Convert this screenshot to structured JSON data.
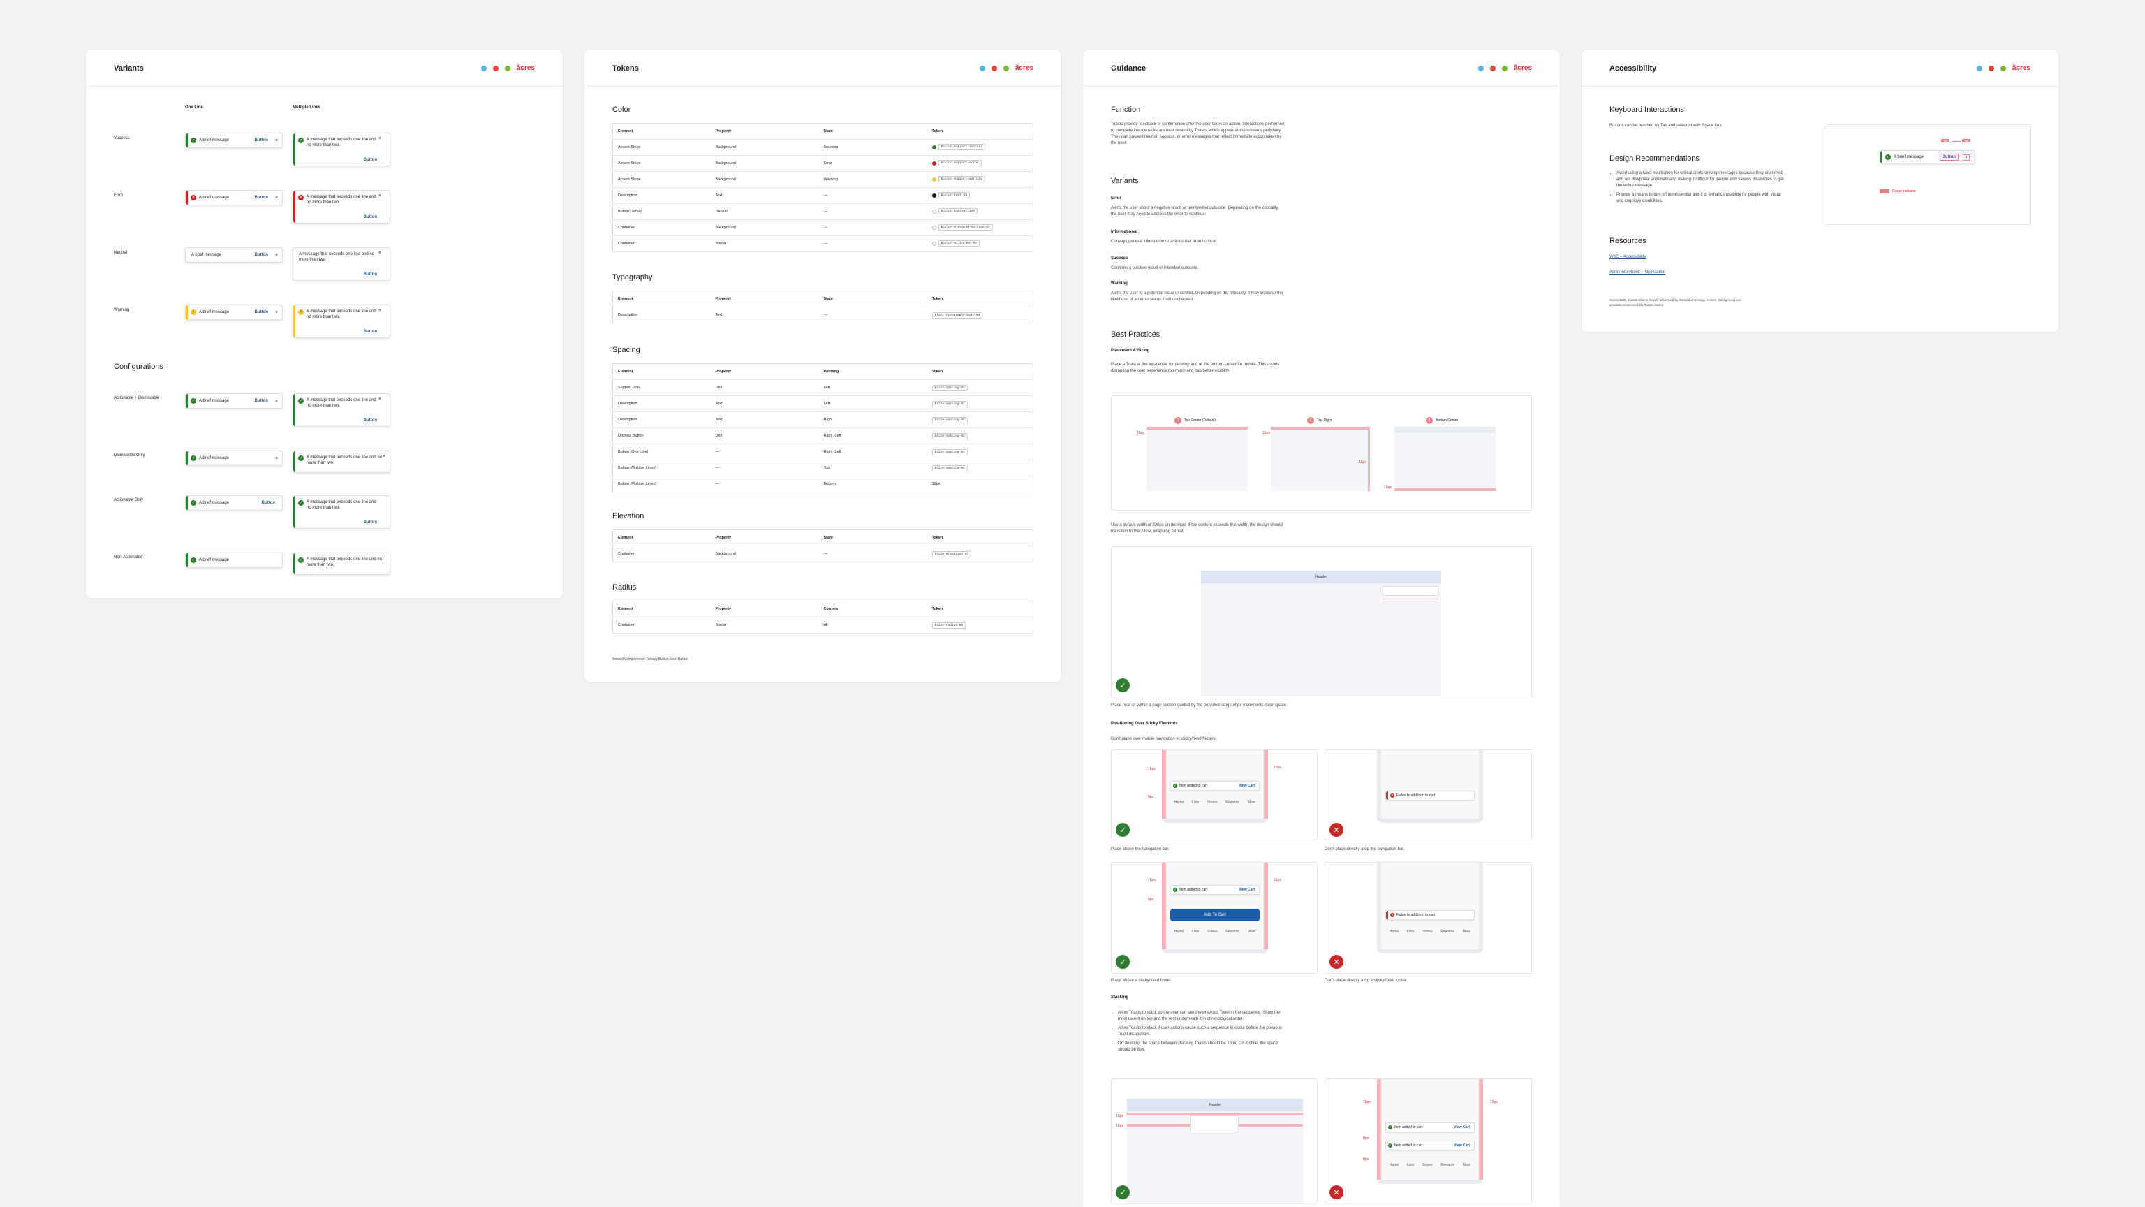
{
  "brand": {
    "name": "ăcres",
    "dots": [
      "#5ab4e8",
      "#e2453a",
      "#7dbb2c"
    ]
  },
  "colors": {
    "success": "#2e7d32",
    "error": "#c62828",
    "warning": "#f2c230",
    "link": "#1e5aa0"
  },
  "variants": {
    "title": "Variants",
    "col_one": "One Line",
    "col_multi": "Multiple Lines",
    "rows": [
      {
        "label": "Success",
        "kind": "success",
        "one": "A brief message",
        "multi": "A message that exceeds one line and no more than two."
      },
      {
        "label": "Error",
        "kind": "error",
        "one": "A brief message",
        "multi": "A message that exceeds one line and no more than two."
      },
      {
        "label": "Neutral",
        "kind": "neutral",
        "one": "A brief message",
        "multi": "A message that exceeds one line and no more than two."
      },
      {
        "label": "Warning",
        "kind": "warning",
        "one": "A brief message",
        "multi": "A message that exceeds one line and no more than two."
      }
    ],
    "config_title": "Configurations",
    "configs": [
      {
        "label": "Actionable + Dismissible",
        "one": "A brief message",
        "multi": "A message that exceeds one line and no more than two."
      },
      {
        "label": "Dismissible Only",
        "one": "A brief message",
        "multi": "A message that exceeds one line and no more than two."
      },
      {
        "label": "Actionable Only",
        "one": "A brief message",
        "multi": "A message that exceeds one line and no more than two."
      },
      {
        "label": "Non-Actionable",
        "one": "A brief message",
        "multi": "A message that exceeds one line and no more than two."
      }
    ],
    "button_label": "Button",
    "close": "×"
  },
  "tokens": {
    "title": "Tokens",
    "color": {
      "title": "Color",
      "head": [
        "Element",
        "Property",
        "State",
        "Token"
      ],
      "rows": [
        [
          "Accent Stripe",
          "Background",
          "Success",
          "$color-support-success"
        ],
        [
          "Accent Stripe",
          "Background",
          "Error",
          "$color-support-error"
        ],
        [
          "Accent Stripe",
          "Background",
          "Warning",
          "$color-support-warning"
        ],
        [
          "Description",
          "Text",
          "—",
          "$color-text-01"
        ],
        [
          "Button (Tertia)",
          "Default",
          "—",
          "$color-interactive"
        ],
        [
          "Container",
          "Background",
          "—",
          "$color-elevated-surface-0x"
        ],
        [
          "Container",
          "Border",
          "—",
          "$color-ui-border-0x"
        ]
      ],
      "swatches": [
        "#2e7d32",
        "#c62828",
        "#f2c230",
        "#1b1b1b",
        "#ffffff",
        "#ffffff",
        "#ffffff"
      ]
    },
    "typography": {
      "title": "Typography",
      "head": [
        "Element",
        "Property",
        "State",
        "Token"
      ],
      "rows": [
        [
          "Description",
          "Text",
          "—",
          "$font-typography-body-04"
        ]
      ]
    },
    "spacing": {
      "title": "Spacing",
      "head": [
        "Element",
        "Property",
        "Padding",
        "Token"
      ],
      "rows": [
        [
          "Support Icon",
          "Drill",
          "Left",
          "$size-spacing-04"
        ],
        [
          "Description",
          "Text",
          "Left",
          "$size-spacing-04"
        ],
        [
          "Description",
          "Text",
          "Right",
          "$size-spacing-04"
        ],
        [
          "Dismiss Button",
          "Drill",
          "Right, Left",
          "$size-spacing-04"
        ],
        [
          "Button (One Line)",
          "—",
          "Right, Left",
          "$size-spacing-04"
        ],
        [
          "Button (Multiple Lines)",
          "—",
          "Top",
          "$size-spacing-04"
        ],
        [
          "Button (Multiple Lines)",
          "—",
          "Bottom",
          "16px"
        ]
      ]
    },
    "elevation": {
      "title": "Elevation",
      "head": [
        "Element",
        "Property",
        "State",
        "Token"
      ],
      "rows": [
        [
          "Container",
          "Background",
          "—",
          "$size-elevation-04"
        ]
      ]
    },
    "radius": {
      "title": "Radius",
      "head": [
        "Element",
        "Property",
        "Corners",
        "Token"
      ],
      "rows": [
        [
          "Container",
          "Border",
          "All",
          "$size-radius-04"
        ]
      ]
    },
    "footnote": "Nested Components: Tertiary Button, Icon Button"
  },
  "guidance": {
    "title": "Guidance",
    "function_title": "Function",
    "function_body": "Toasts provide feedback or confirmation after the user takes an action. Interactions performed to complete invoice tasks are best served by Toasts, which appear at the screen's periphery. They can present neutral, success, or error messages that reflect immediate action taken by the user.",
    "variants_title": "Variants",
    "variants": [
      {
        "name": "Error",
        "body": "Alerts the user about a negative result or unintended outcome. Depending on the criticality, the user may need to address the error to continue."
      },
      {
        "name": "Informational",
        "body": "Conveys general information or actions that aren't critical."
      },
      {
        "name": "Success",
        "body": "Confirms a positive result or intended outcome."
      },
      {
        "name": "Warning",
        "body": "Alerts the user to a potential issue or conflict. Depending on the criticality, it may increase the likelihood of an error status if left unchecked."
      }
    ],
    "best_title": "Best Practices",
    "placement_title": "Placement & Sizing",
    "placement_body": "Place a Toast at the top-center for desktop and at the bottom-center for mobile. This avoids disrupting the user experience too much and has better visibility.",
    "positions": [
      "Top Center (Default)",
      "Top Right",
      "Bottom Center"
    ],
    "position_nums": [
      "1",
      "2",
      "3"
    ],
    "width_body": "Use a default width of 320px on desktop. If the content exceeds this width, the design should transition to the 2-line, wrapping format.",
    "header_label": "Header",
    "space_body": "Place near or within a page section guided by the provided range of px increments clear space.",
    "sticky_title": "Positioning Over Sticky Elements",
    "sticky_body": "Don't place over mobile navigation or sticky/fixed footers.",
    "toast_added": "Item added to cart",
    "toast_view": "View Cart",
    "toast_failed": "Failed to add item to cart",
    "add_to_cart": "Add To Cart",
    "nav_items": [
      "Home",
      "Lists",
      "Stores",
      "Rewards",
      "More"
    ],
    "caption_1": "Place above the navigation bar.",
    "caption_2": "Don't place directly atop the navigation bar.",
    "caption_3": "Place above a sticky/fixed footer.",
    "caption_4": "Don't place directly atop a sticky/fixed footer.",
    "stacking_title": "Stacking",
    "stacking_items": [
      "Allow Toasts to stack so the user can see the previous Toast in the sequence. Show the most recent on top and the rest underneath it in chronological order.",
      "Allow Toasts to stack if user actions cause such a sequence to occur before the previous Toast disappears.",
      "On desktop, the space between stacking Toasts should be 16px. On mobile, the space should be 8px."
    ],
    "measures": [
      "16px",
      "12px",
      "8px",
      "32px",
      "24px"
    ]
  },
  "accessibility": {
    "title": "Accessibility",
    "keyboard_title": "Keyboard Interactions",
    "keyboard_body": "Buttons can be reached by Tab and selected with Space key.",
    "design_title": "Design Recommendations",
    "design_items": [
      "Avoid using a toast notification for critical alerts or long messages because they are timed and will disappear automatically, making it difficult for people with various disabilities to get the entire message.",
      "Provide a means to turn off nonessential alerts to enhance usability for people with visual and cognitive disabilities."
    ],
    "resources_title": "Resources",
    "links": [
      "W3C – Accessibility",
      "Acres Storybook – Notification"
    ],
    "fine_print": "Accessibility documentation heavily influenced by the Carbon Design System. Background and annotations accessibility Toasts, Notes.",
    "focus_legend": "Focus indicator",
    "demo_message": "A brief message",
    "demo_button": "Button",
    "tab_labels": [
      "Tab",
      "Tab"
    ]
  }
}
